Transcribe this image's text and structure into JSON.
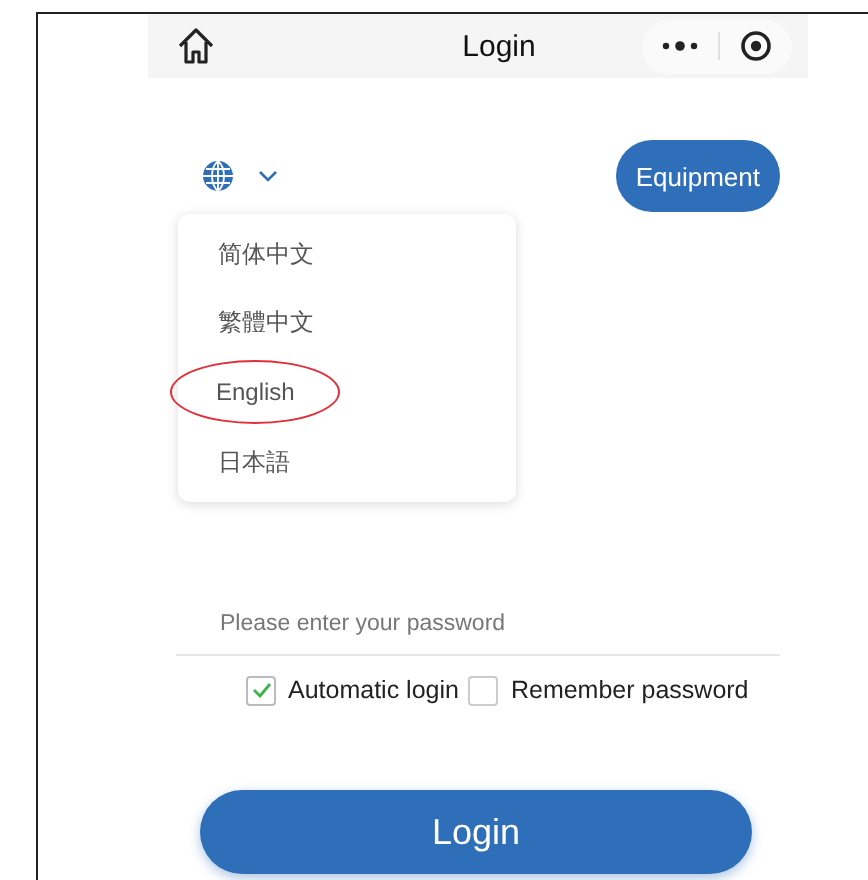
{
  "nav_bar": {
    "title": "Login"
  },
  "language_menu": {
    "expanded": true,
    "items": [
      {
        "label": "简体中文",
        "circled": false
      },
      {
        "label": "繁體中文",
        "circled": false
      },
      {
        "label": "English",
        "circled": true
      },
      {
        "label": "日本語",
        "circled": false
      }
    ]
  },
  "equipment_button": "Equipment",
  "password_field": {
    "placeholder": "Please enter your password"
  },
  "options": [
    {
      "label": "Automatic login",
      "checked": true
    },
    {
      "label": "Remember password",
      "checked": false
    }
  ],
  "login_button": "Login"
}
